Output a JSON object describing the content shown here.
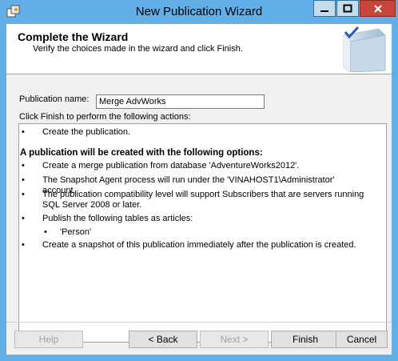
{
  "window": {
    "title": "New Publication Wizard",
    "icon": "wizard-app-icon",
    "controls": {
      "minimize": "minimize-icon",
      "maximize": "maximize-icon",
      "close": "close-icon"
    }
  },
  "header": {
    "title": "Complete the Wizard",
    "subtitle": "Verify the choices made in the wizard and click Finish.",
    "graphic": "book-check-icon"
  },
  "form": {
    "publication_name_label": "Publication name:",
    "publication_name_value": "Merge AdvWorks",
    "instructions": "Click Finish to perform the following actions:"
  },
  "actions": {
    "bullet": "•",
    "first_action": "Create the publication.",
    "options_heading": "A publication will be created with the following options:",
    "options": [
      "Create a merge publication from database 'AdventureWorks2012'.",
      "The Snapshot Agent process will run under the 'VINAHOST1\\Administrator' account.",
      "The publication compatibility level will support Subscribers that are servers running SQL Server 2008 or later.",
      "Publish the following tables as articles:",
      "'Person'",
      "Create a snapshot of this publication immediately after the publication is created."
    ]
  },
  "buttons": {
    "help": "Help",
    "back": "< Back",
    "next": "Next >",
    "finish": "Finish",
    "cancel": "Cancel"
  }
}
